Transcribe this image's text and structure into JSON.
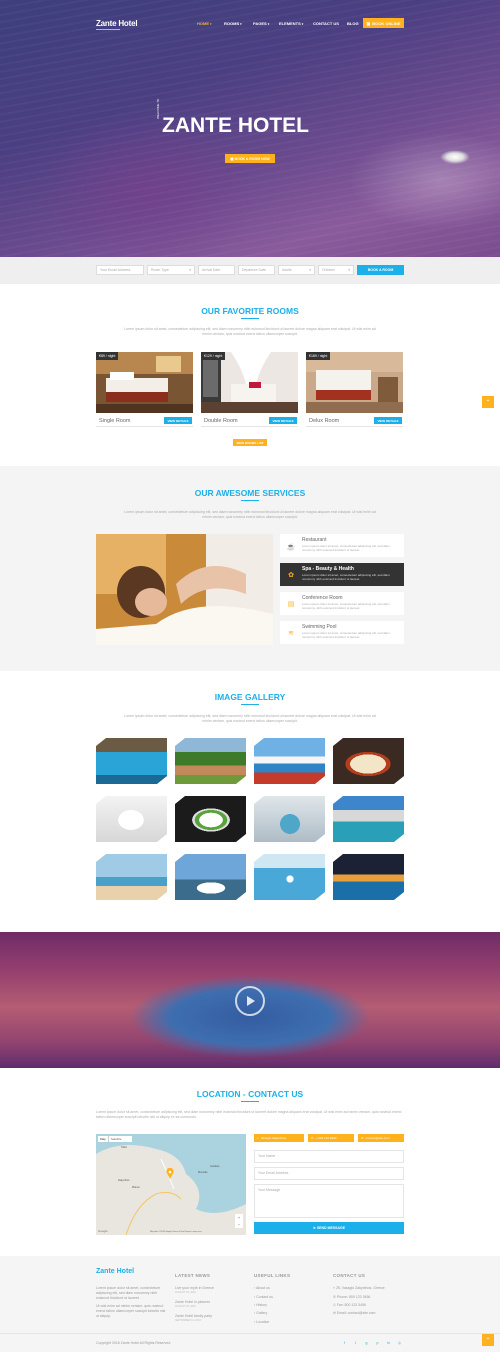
{
  "header": {
    "logo": "Zante Hotel",
    "nav": [
      "HOME",
      "ROOMS",
      "PAGES",
      "ELEMENTS",
      "CONTACT US",
      "BLOG"
    ],
    "book_online": "BOOK ONLINE"
  },
  "hero": {
    "pretitle": "WELCOME TO",
    "title": "ZANTE HOTEL",
    "button": "BOOK A ROOM NOW"
  },
  "booking": {
    "email_placeholder": "Your Email Address",
    "room_type": "Room Type",
    "arrival": "Arrival Date",
    "departure": "Departure Date",
    "adults": "Adults",
    "children": "Children",
    "button": "BOOK A ROOM"
  },
  "rooms": {
    "title": "OUR FAVORITE ROOMS",
    "desc": "Lorem ipsum dolor sit amet, consectetuer adipiscing elit, sed diam nonummy nibh euismod tincidunt ut laoreet dolore magna aliquam erat volutpat. Ut wisi enim ad minim veniam, quis nostrud exerci tation ullamcorper suscipit.",
    "items": [
      {
        "price": "€89 / night",
        "name": "Single Room",
        "button": "VIEW DETAILS"
      },
      {
        "price": "€129 / night",
        "name": "Double Room",
        "button": "VIEW DETAILS"
      },
      {
        "price": "€189 / night",
        "name": "Delux Room",
        "button": "VIEW DETAILS"
      }
    ],
    "all_button": "VIEW ROOMS LIST"
  },
  "services": {
    "title": "OUR AWESOME SERVICES",
    "desc": "Lorem ipsum dolor sit amet, consectetuer adipiscing elit, sed diam nonummy nibh euismod tincidunt ut laoreet dolore magna aliquam erat volutpat. Ut wisi enim ad minim veniam, quis nostrud exerci tation ullamcorper suscipit.",
    "items": [
      {
        "title": "Restaurant",
        "text": "Lorem ipsum dolor sit amet, consectetuer adipiscing elit, sed diam nonummy nibh euismod tincidunt ut laoreet."
      },
      {
        "title": "Spa - Beauty & Health",
        "text": "Lorem ipsum dolor sit amet, consectetuer adipiscing elit, sed diam nonummy nibh euismod tincidunt ut laoreet."
      },
      {
        "title": "Conference Room",
        "text": "Lorem ipsum dolor sit amet, consectetuer adipiscing elit, sed diam nonummy nibh euismod tincidunt ut laoreet."
      },
      {
        "title": "Swimming Pool",
        "text": "Lorem ipsum dolor sit amet, consectetuer adipiscing elit, sed diam nonummy nibh euismod tincidunt ut laoreet."
      }
    ]
  },
  "gallery": {
    "title": "IMAGE GALLERY",
    "desc": "Lorem ipsum dolor sit amet, consectetuer adipiscing elit, sed diam nonummy nibh euismod tincidunt ut laoreet dolore magna aliquam erat volutpat. Ut wisi enim ad minim veniam, quis nostrud exerci tation ullamcorper suscipit."
  },
  "contact": {
    "title": "LOCATION - CONTACT US",
    "desc": "Lorem ipsum dolor sit amet, consectetuer adipiscing elit, sed diam nonummy nibh euismod tincidunt ut laoreet dolore magna aliquam erat volutpat. Ut wisi enim ad minim veniam, quis nostrud exerci tation ullamcorper suscipit lobortis nisl ut aliquip ex ea commodo.",
    "map_tabs": [
      "Map",
      "Satellite"
    ],
    "map_labels": [
      "Zakynthos",
      "Tsilivi",
      "Planos",
      "Gerakas",
      "Mouzaki"
    ],
    "map_footer": "Map data ©2016 Google  Terms of Use  Report a map error",
    "badges": [
      "Vasaglo Zakynthos",
      "+ 000 123 9900",
      "contact@site.com"
    ],
    "name_placeholder": "Your Name",
    "email_placeholder": "Your Email Address",
    "message_placeholder": "Your Message",
    "send": "SEND MESSAGE"
  },
  "footer": {
    "logo": "Zante Hotel",
    "about": "Lorem ipsum dolor sit amet, consectetuer adipiscing elit, sed diam nonummy nibh euismod tincidunt ut laoreet.",
    "about2": "Ut wisi enim ad minim veniam, quis nostrud exerci tation ullamcorper suscipit lobortis nisl ut aliquip.",
    "latest_news_title": "LATEST NEWS",
    "news": [
      {
        "title": "Live your myth in Greece",
        "date": "AUGUST 10, 2016"
      },
      {
        "title": "Zante Hotel in pictures",
        "date": "AUGUST 18, 2016"
      },
      {
        "title": "Zante Hotel family party",
        "date": "SEPTEMBER 19, 2016"
      }
    ],
    "links_title": "USEFUL LINKS",
    "links": [
      "About us",
      "Contact us",
      "History",
      "Gallery",
      "Location"
    ],
    "contact_title": "CONTACT US",
    "contacts": [
      "25, Vasaglo Zakynthos, Greece",
      "Phone: 800 123 3456",
      "Fax: 800 123 3456",
      "Email: contact@site.com"
    ],
    "copyright": "Copyright 2016 Zante Hotel All Rights Reserved."
  },
  "colors": {
    "accent": "#1bb0ea",
    "gold": "#ffb21d",
    "dark": "#333333"
  }
}
